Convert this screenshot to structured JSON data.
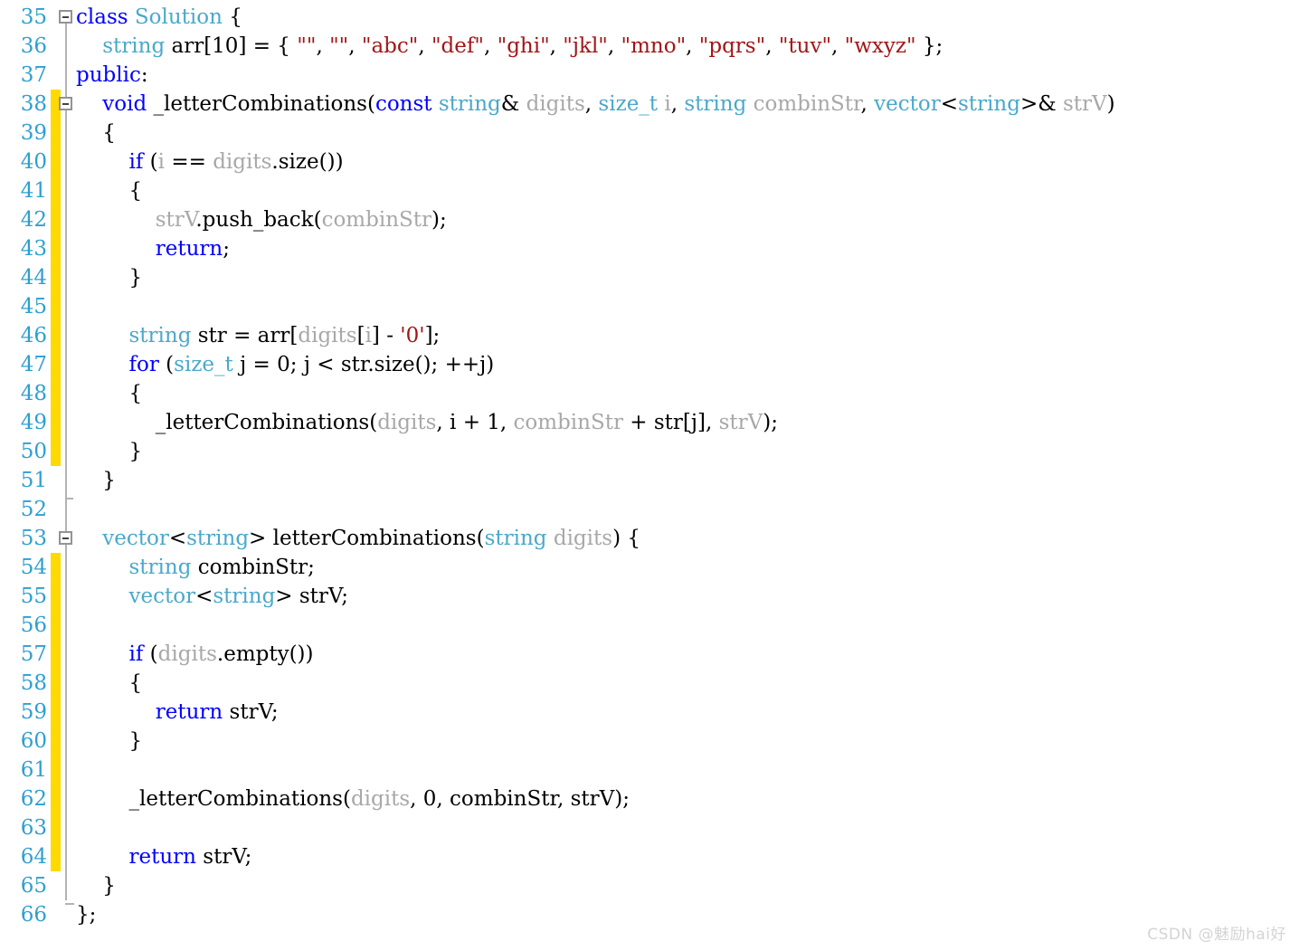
{
  "editor": {
    "language": "cpp",
    "first_line": 35,
    "last_line": 66,
    "colors": {
      "background": "#ffffff",
      "line_number": "#2e9fd0",
      "change_marker": "#ffd900",
      "keyword": "#0000ff",
      "type": "#4aa8cc",
      "parameter": "#a8a8a8",
      "string": "#a31515",
      "plain": "#000000",
      "guide_line": "#b3b3b3",
      "watermark": "#d4d4d4"
    }
  },
  "gutter": {
    "line_numbers": [
      "35",
      "36",
      "37",
      "38",
      "39",
      "40",
      "41",
      "42",
      "43",
      "44",
      "45",
      "46",
      "47",
      "48",
      "49",
      "50",
      "51",
      "52",
      "53",
      "54",
      "55",
      "56",
      "57",
      "58",
      "59",
      "60",
      "61",
      "62",
      "63",
      "64",
      "65",
      "66"
    ],
    "fold_markers": [
      {
        "line": 35,
        "state": "expanded",
        "glyph": "minus"
      },
      {
        "line": 38,
        "state": "expanded",
        "glyph": "minus"
      },
      {
        "line": 53,
        "state": "expanded",
        "glyph": "minus"
      }
    ],
    "change_bars": [
      {
        "from_line": 38,
        "to_line": 50
      },
      {
        "from_line": 54,
        "to_line": 64
      }
    ]
  },
  "code_lines": [
    {
      "n": 35,
      "tokens": [
        {
          "t": "class ",
          "c": "kw"
        },
        {
          "t": "Solution",
          "c": "typ"
        },
        {
          "t": " {",
          "c": "pln"
        }
      ]
    },
    {
      "n": 36,
      "tokens": [
        {
          "t": "    ",
          "c": "pln"
        },
        {
          "t": "string",
          "c": "typ"
        },
        {
          "t": " arr[10] = { ",
          "c": "pln"
        },
        {
          "t": "\"\"",
          "c": "str"
        },
        {
          "t": ", ",
          "c": "pln"
        },
        {
          "t": "\"\"",
          "c": "str"
        },
        {
          "t": ", ",
          "c": "pln"
        },
        {
          "t": "\"abc\"",
          "c": "str"
        },
        {
          "t": ", ",
          "c": "pln"
        },
        {
          "t": "\"def\"",
          "c": "str"
        },
        {
          "t": ", ",
          "c": "pln"
        },
        {
          "t": "\"ghi\"",
          "c": "str"
        },
        {
          "t": ", ",
          "c": "pln"
        },
        {
          "t": "\"jkl\"",
          "c": "str"
        },
        {
          "t": ", ",
          "c": "pln"
        },
        {
          "t": "\"mno\"",
          "c": "str"
        },
        {
          "t": ", ",
          "c": "pln"
        },
        {
          "t": "\"pqrs\"",
          "c": "str"
        },
        {
          "t": ", ",
          "c": "pln"
        },
        {
          "t": "\"tuv\"",
          "c": "str"
        },
        {
          "t": ", ",
          "c": "pln"
        },
        {
          "t": "\"wxyz\"",
          "c": "str"
        },
        {
          "t": " };",
          "c": "pln"
        }
      ]
    },
    {
      "n": 37,
      "tokens": [
        {
          "t": "public",
          "c": "kw"
        },
        {
          "t": ":",
          "c": "pln"
        }
      ]
    },
    {
      "n": 38,
      "tokens": [
        {
          "t": "    ",
          "c": "pln"
        },
        {
          "t": "void",
          "c": "kw"
        },
        {
          "t": " _letterCombinations(",
          "c": "pln"
        },
        {
          "t": "const",
          "c": "kw"
        },
        {
          "t": " ",
          "c": "pln"
        },
        {
          "t": "string",
          "c": "typ"
        },
        {
          "t": "& ",
          "c": "pln"
        },
        {
          "t": "digits",
          "c": "par"
        },
        {
          "t": ", ",
          "c": "pln"
        },
        {
          "t": "size_t",
          "c": "typ"
        },
        {
          "t": " ",
          "c": "pln"
        },
        {
          "t": "i",
          "c": "par"
        },
        {
          "t": ", ",
          "c": "pln"
        },
        {
          "t": "string",
          "c": "typ"
        },
        {
          "t": " ",
          "c": "pln"
        },
        {
          "t": "combinStr",
          "c": "par"
        },
        {
          "t": ", ",
          "c": "pln"
        },
        {
          "t": "vector",
          "c": "typ"
        },
        {
          "t": "<",
          "c": "pln"
        },
        {
          "t": "string",
          "c": "typ"
        },
        {
          "t": ">& ",
          "c": "pln"
        },
        {
          "t": "strV",
          "c": "par"
        },
        {
          "t": ")",
          "c": "pln"
        }
      ]
    },
    {
      "n": 39,
      "tokens": [
        {
          "t": "    {",
          "c": "pln"
        }
      ]
    },
    {
      "n": 40,
      "tokens": [
        {
          "t": "        ",
          "c": "pln"
        },
        {
          "t": "if",
          "c": "kw"
        },
        {
          "t": " (",
          "c": "pln"
        },
        {
          "t": "i",
          "c": "par"
        },
        {
          "t": " == ",
          "c": "pln"
        },
        {
          "t": "digits",
          "c": "par"
        },
        {
          "t": ".size())",
          "c": "pln"
        }
      ]
    },
    {
      "n": 41,
      "tokens": [
        {
          "t": "        {",
          "c": "pln"
        }
      ]
    },
    {
      "n": 42,
      "tokens": [
        {
          "t": "            ",
          "c": "pln"
        },
        {
          "t": "strV",
          "c": "par"
        },
        {
          "t": ".push_back(",
          "c": "pln"
        },
        {
          "t": "combinStr",
          "c": "par"
        },
        {
          "t": ");",
          "c": "pln"
        }
      ]
    },
    {
      "n": 43,
      "tokens": [
        {
          "t": "            ",
          "c": "pln"
        },
        {
          "t": "return",
          "c": "kw"
        },
        {
          "t": ";",
          "c": "pln"
        }
      ]
    },
    {
      "n": 44,
      "tokens": [
        {
          "t": "        }",
          "c": "pln"
        }
      ]
    },
    {
      "n": 45,
      "tokens": [
        {
          "t": "",
          "c": "pln"
        }
      ]
    },
    {
      "n": 46,
      "tokens": [
        {
          "t": "        ",
          "c": "pln"
        },
        {
          "t": "string",
          "c": "typ"
        },
        {
          "t": " str = arr[",
          "c": "pln"
        },
        {
          "t": "digits",
          "c": "par"
        },
        {
          "t": "[",
          "c": "pln"
        },
        {
          "t": "i",
          "c": "par"
        },
        {
          "t": "] - ",
          "c": "pln"
        },
        {
          "t": "'0'",
          "c": "str"
        },
        {
          "t": "];",
          "c": "pln"
        }
      ]
    },
    {
      "n": 47,
      "tokens": [
        {
          "t": "        ",
          "c": "pln"
        },
        {
          "t": "for",
          "c": "kw"
        },
        {
          "t": " (",
          "c": "pln"
        },
        {
          "t": "size_t",
          "c": "typ"
        },
        {
          "t": " j = 0; j < str.size(); ++j)",
          "c": "pln"
        }
      ]
    },
    {
      "n": 48,
      "tokens": [
        {
          "t": "        {",
          "c": "pln"
        }
      ]
    },
    {
      "n": 49,
      "tokens": [
        {
          "t": "            _letterCombinations(",
          "c": "pln"
        },
        {
          "t": "digits",
          "c": "par"
        },
        {
          "t": ", i + 1, ",
          "c": "pln"
        },
        {
          "t": "combinStr",
          "c": "par"
        },
        {
          "t": " + str[j], ",
          "c": "pln"
        },
        {
          "t": "strV",
          "c": "par"
        },
        {
          "t": ");",
          "c": "pln"
        }
      ]
    },
    {
      "n": 50,
      "tokens": [
        {
          "t": "        }",
          "c": "pln"
        }
      ]
    },
    {
      "n": 51,
      "tokens": [
        {
          "t": "    }",
          "c": "pln"
        }
      ]
    },
    {
      "n": 52,
      "tokens": [
        {
          "t": "",
          "c": "pln"
        }
      ]
    },
    {
      "n": 53,
      "tokens": [
        {
          "t": "    ",
          "c": "pln"
        },
        {
          "t": "vector",
          "c": "typ"
        },
        {
          "t": "<",
          "c": "pln"
        },
        {
          "t": "string",
          "c": "typ"
        },
        {
          "t": "> letterCombinations(",
          "c": "pln"
        },
        {
          "t": "string",
          "c": "typ"
        },
        {
          "t": " ",
          "c": "pln"
        },
        {
          "t": "digits",
          "c": "par"
        },
        {
          "t": ") {",
          "c": "pln"
        }
      ]
    },
    {
      "n": 54,
      "tokens": [
        {
          "t": "        ",
          "c": "pln"
        },
        {
          "t": "string",
          "c": "typ"
        },
        {
          "t": " combinStr;",
          "c": "pln"
        }
      ]
    },
    {
      "n": 55,
      "tokens": [
        {
          "t": "        ",
          "c": "pln"
        },
        {
          "t": "vector",
          "c": "typ"
        },
        {
          "t": "<",
          "c": "pln"
        },
        {
          "t": "string",
          "c": "typ"
        },
        {
          "t": "> strV;",
          "c": "pln"
        }
      ]
    },
    {
      "n": 56,
      "tokens": [
        {
          "t": "",
          "c": "pln"
        }
      ]
    },
    {
      "n": 57,
      "tokens": [
        {
          "t": "        ",
          "c": "pln"
        },
        {
          "t": "if",
          "c": "kw"
        },
        {
          "t": " (",
          "c": "pln"
        },
        {
          "t": "digits",
          "c": "par"
        },
        {
          "t": ".empty())",
          "c": "pln"
        }
      ]
    },
    {
      "n": 58,
      "tokens": [
        {
          "t": "        {",
          "c": "pln"
        }
      ]
    },
    {
      "n": 59,
      "tokens": [
        {
          "t": "            ",
          "c": "pln"
        },
        {
          "t": "return",
          "c": "kw"
        },
        {
          "t": " strV;",
          "c": "pln"
        }
      ]
    },
    {
      "n": 60,
      "tokens": [
        {
          "t": "        }",
          "c": "pln"
        }
      ]
    },
    {
      "n": 61,
      "tokens": [
        {
          "t": "",
          "c": "pln"
        }
      ]
    },
    {
      "n": 62,
      "tokens": [
        {
          "t": "        _letterCombinations(",
          "c": "pln"
        },
        {
          "t": "digits",
          "c": "par"
        },
        {
          "t": ", 0, combinStr, strV);",
          "c": "pln"
        }
      ]
    },
    {
      "n": 63,
      "tokens": [
        {
          "t": "",
          "c": "pln"
        }
      ]
    },
    {
      "n": 64,
      "tokens": [
        {
          "t": "        ",
          "c": "pln"
        },
        {
          "t": "return",
          "c": "kw"
        },
        {
          "t": " strV;",
          "c": "pln"
        }
      ]
    },
    {
      "n": 65,
      "tokens": [
        {
          "t": "    }",
          "c": "pln"
        }
      ]
    },
    {
      "n": 66,
      "tokens": [
        {
          "t": "};",
          "c": "pln"
        }
      ]
    }
  ],
  "watermark": {
    "text": "CSDN @魅励hai好"
  }
}
